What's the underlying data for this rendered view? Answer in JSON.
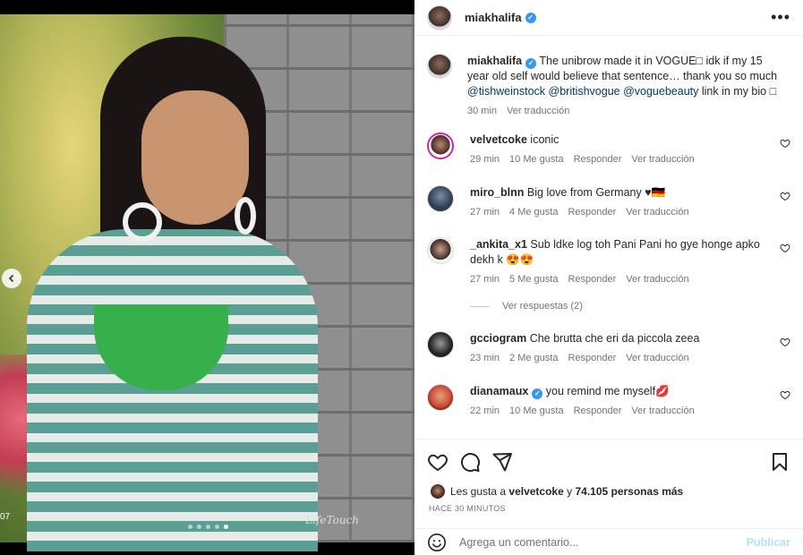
{
  "media": {
    "counter": "07",
    "signature": "LifeTouch",
    "dots_total": 5,
    "dots_active": 5
  },
  "post": {
    "username": "miakhalifa",
    "more": "•••"
  },
  "caption": {
    "username": "miakhalifa",
    "text_pre": " The unibrow made it in VOGUE□ idk if my 15 year old self would believe that sentence… thank you so much ",
    "mentions": [
      "@tishweinstock",
      "@britishvogue",
      "@voguebeauty"
    ],
    "text_post": " link in my bio □",
    "time": "30 min",
    "translate": "Ver traducción"
  },
  "comments": [
    {
      "user": "velvetcoke",
      "text": "iconic",
      "time": "29 min",
      "likes": "10 Me gusta",
      "reply": "Responder",
      "translate": "Ver traducción",
      "verified": false
    },
    {
      "user": "miro_blnn",
      "text": "Big love from Germany ♥🇩🇪",
      "time": "27 min",
      "likes": "4 Me gusta",
      "reply": "Responder",
      "translate": "Ver traducción",
      "verified": false
    },
    {
      "user": "_ankita_x1",
      "text": "Sub ldke log toh Pani Pani ho gye honge apko dekh k 😍😍",
      "time": "27 min",
      "likes": "5 Me gusta",
      "reply": "Responder",
      "translate": "Ver traducción",
      "verified": false
    },
    {
      "user": "gcciogram",
      "text": "Che brutta che eri da piccola zeea",
      "time": "23 min",
      "likes": "2 Me gusta",
      "reply": "Responder",
      "translate": "Ver traducción",
      "verified": false
    },
    {
      "user": "dianamaux",
      "text": "you remind me myself💋",
      "time": "22 min",
      "likes": "10 Me gusta",
      "reply": "Responder",
      "translate": "Ver traducción",
      "verified": true
    }
  ],
  "view_replies": "Ver respuestas (2)",
  "likes": {
    "prefix": "Les gusta a ",
    "user": "velvetcoke",
    "middle": " y ",
    "count": "74.105 personas más"
  },
  "posted_ago": "HACE 30 MINUTOS",
  "composer": {
    "placeholder": "Agrega un comentario...",
    "post_label": "Publicar"
  },
  "colors": {
    "link": "#00376b",
    "verified": "#3897f0",
    "muted": "#737373",
    "post_disabled": "#b2dffc"
  }
}
